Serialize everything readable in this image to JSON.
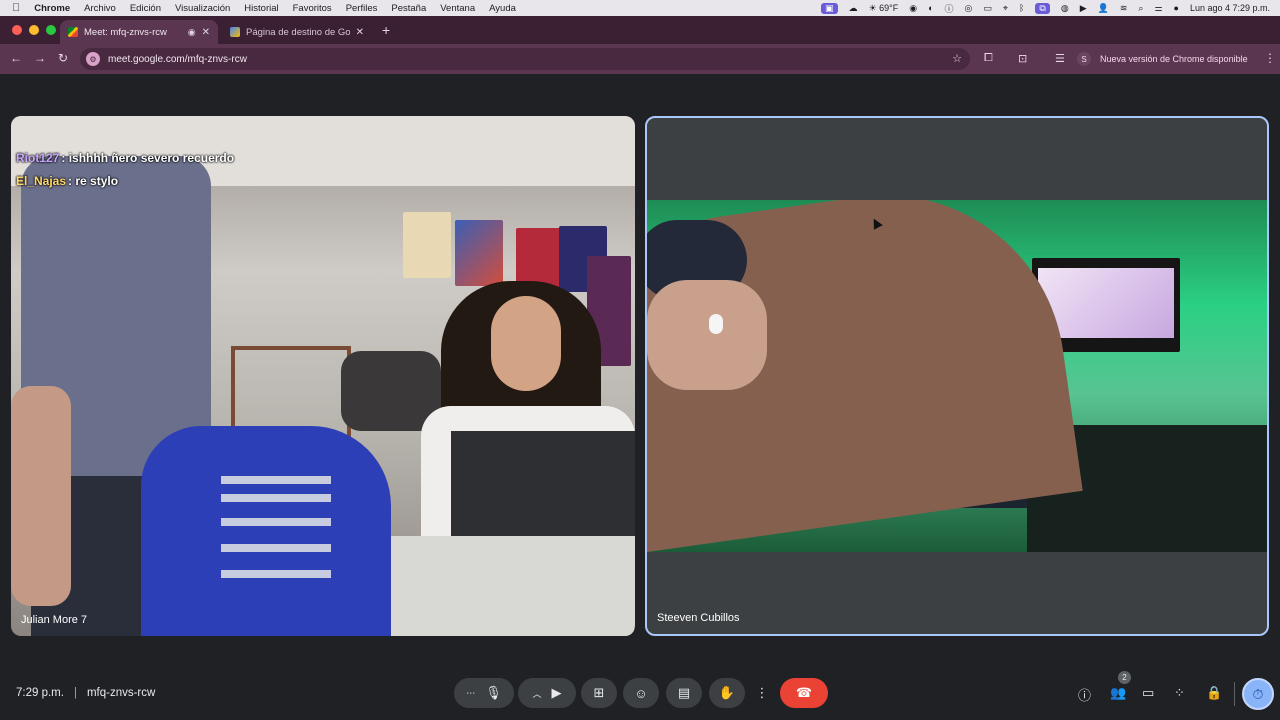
{
  "menubar": {
    "apple": "",
    "app_name": "Chrome",
    "menus": [
      "Archivo",
      "Edición",
      "Visualización",
      "Historial",
      "Favoritos",
      "Perfiles",
      "Pestaña",
      "Ventana",
      "Ayuda"
    ],
    "weather": "69°F",
    "datetime": "Lun ago 4  7:29 p.m."
  },
  "tabs": [
    {
      "title": "Meet: mfq-znvs-rcw",
      "active": true
    },
    {
      "title": "Página de destino de Google",
      "active": false
    }
  ],
  "toolbar": {
    "url": "meet.google.com/mfq-znvs-rcw",
    "profile_initial": "S",
    "update_label": "Nueva versión de Chrome disponible"
  },
  "tiles": {
    "left": {
      "name": "Julian More 7",
      "chat": [
        {
          "user": "Riot127",
          "user_color": "#c9a6ff",
          "text": ": ishhhh ñero severo recuerdo"
        },
        {
          "user": "El_Najas",
          "user_color": "#ffd86b",
          "text": ": re stylo"
        }
      ]
    },
    "right": {
      "name": "Steeven Cubillos"
    }
  },
  "bottom": {
    "time": "7:29 p.m.",
    "separator": "|",
    "meeting_code": "mfq-znvs-rcw",
    "people_count": "2"
  },
  "colors": {
    "active_speaker_border": "#a8c7fa",
    "end_call": "#ea4335",
    "tab_bg": "#3b1f33",
    "toolbar_bg": "#5a3650"
  }
}
